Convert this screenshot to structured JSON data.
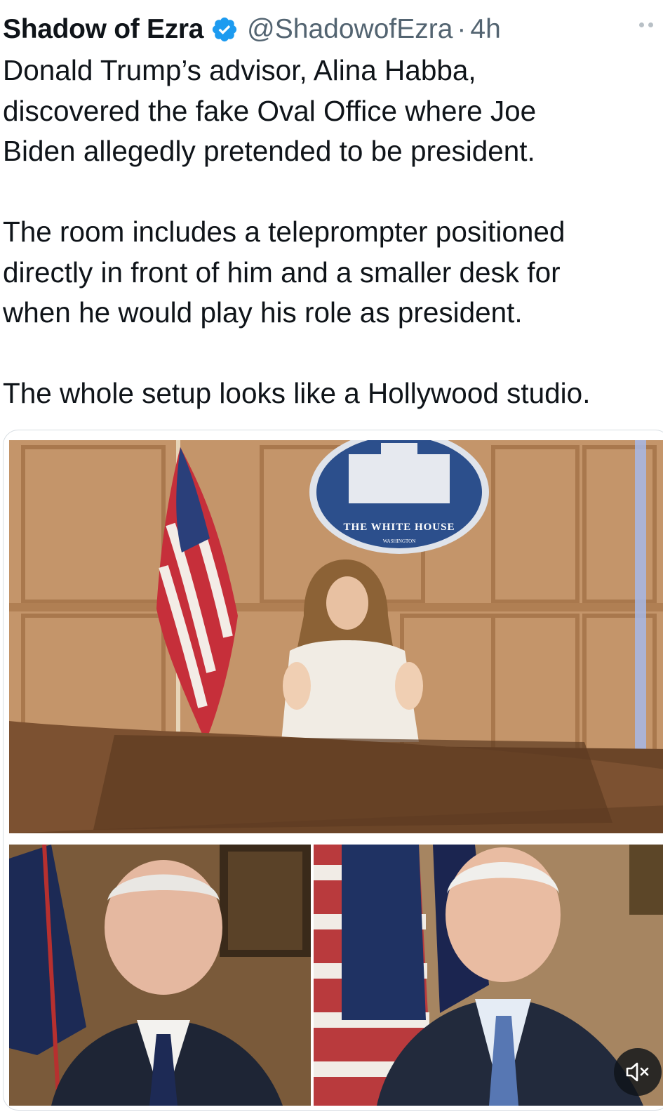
{
  "tweet": {
    "author_name": "Shadow of Ezra",
    "handle": "@ShadowofEzra",
    "separator": "·",
    "time": "4h",
    "paragraphs": [
      "Donald Trump’s advisor, Alina Habba,\ndiscovered the fake Oval Office where Joe\nBiden allegedly pretended to be president.",
      "The room includes a teleprompter positioned\ndirectly in front of him and a smaller desk for\nwhen he would play his role as president.",
      "The whole setup looks like a Hollywood studio."
    ]
  },
  "media": {
    "seal_text": "THE WHITE HOUSE",
    "seal_subtext": "WASHINGTON"
  },
  "icons": {
    "verified": "verified-badge-icon",
    "more": "more-options-icon",
    "mute": "volume-muted-icon"
  },
  "colors": {
    "verified_blue": "#1d9bf0",
    "secondary_text": "#536471",
    "primary_text": "#0f1419"
  }
}
